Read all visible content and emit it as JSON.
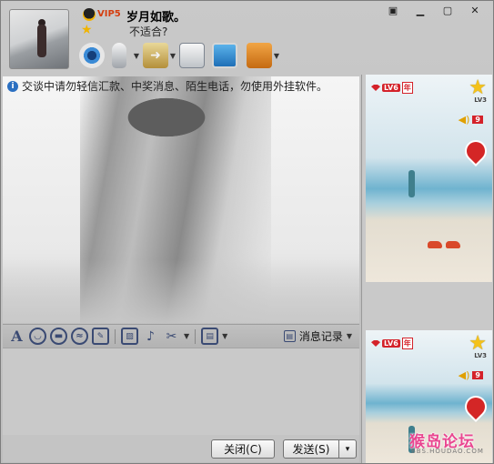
{
  "window": {
    "controls": [
      {
        "name": "menu-button",
        "glyph": "▣"
      },
      {
        "name": "minimize-button",
        "glyph": "▁"
      },
      {
        "name": "maximize-button",
        "glyph": "▢"
      },
      {
        "name": "close-window-button",
        "glyph": "✕"
      }
    ]
  },
  "contact": {
    "vip_label": "VIP5",
    "nickname": "岁月如歌。",
    "signature": "不适合?"
  },
  "toolbar": {
    "items": [
      "video-call",
      "voice-call",
      "send-file",
      "create-discussion",
      "remote-assist",
      "app-box"
    ]
  },
  "notice": {
    "text": "交谈中请勿轻信汇款、中奖消息、陌生电话，勿使用外挂软件。"
  },
  "format_toolbar": {
    "font_glyph": "A",
    "history_label": "消息记录"
  },
  "buttons": {
    "close_label": "关闭(C)",
    "send_label": "发送(S)",
    "send_dropdown_glyph": "▾"
  },
  "show_panel": {
    "level_label": "LV6",
    "year_label": "年",
    "star_level_label": "LV3",
    "volume_value": "9"
  },
  "watermark": {
    "title": "猴岛论坛",
    "subtitle": "BBS.HOUDAO.COM"
  },
  "colors": {
    "window_bg": "#c9c9c9",
    "accent_red": "#d4222a",
    "icon_blue": "#3a4a73",
    "watermark_pink": "#e94690"
  }
}
